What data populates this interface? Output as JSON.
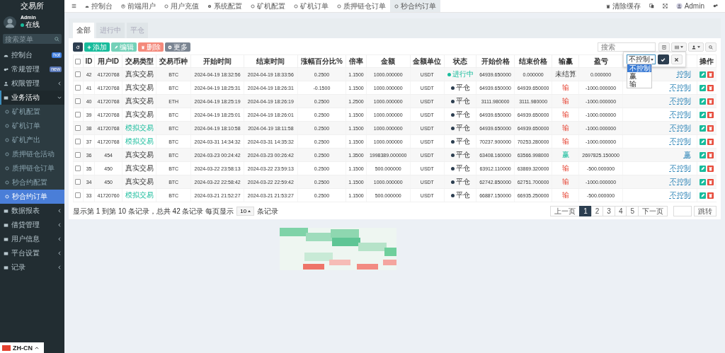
{
  "sidebar": {
    "title": "交易所",
    "user": {
      "name": "Admin",
      "status": "在线"
    },
    "search": {
      "placeholder": "搜索菜单"
    },
    "items": [
      {
        "label": "控制台",
        "badge": {
          "text": "hot",
          "color": "#3f7fe0"
        }
      },
      {
        "label": "常规管理",
        "badge": {
          "text": "new",
          "color": "#5a78b8"
        }
      },
      {
        "label": "权限管理",
        "expanded": false
      },
      {
        "label": "业务活动",
        "expanded": true,
        "children": [
          {
            "label": "矿机配置",
            "selected": false
          },
          {
            "label": "矿机订单",
            "selected": false
          },
          {
            "label": "矿机产出",
            "selected": false
          },
          {
            "label": "质押链仓活动",
            "selected": false
          },
          {
            "label": "质押链仓订单",
            "selected": false
          },
          {
            "label": "秒合约配置",
            "selected": false
          },
          {
            "label": "秒合约订单",
            "selected": true
          }
        ]
      },
      {
        "label": "数据报表",
        "expanded": false
      },
      {
        "label": "借贷管理",
        "expanded": false
      },
      {
        "label": "用户信息",
        "expanded": false
      },
      {
        "label": "平台设置",
        "expanded": false
      },
      {
        "label": "记录",
        "expanded": false
      }
    ],
    "language": "ZH-CN"
  },
  "top_nav": {
    "items": [
      {
        "label": "控制台",
        "selected": false
      },
      {
        "label": "前端用户",
        "selected": false
      },
      {
        "label": "用户充值",
        "selected": false
      },
      {
        "label": "系统配置",
        "selected": false
      },
      {
        "label": "矿机配置",
        "selected": false
      },
      {
        "label": "矿机订单",
        "selected": false
      },
      {
        "label": "质押链仓订单",
        "selected": false
      },
      {
        "label": "秒合约订单",
        "selected": true
      }
    ],
    "clear_cache": "清除缓存",
    "user": "Admin"
  },
  "tabs": [
    {
      "label": "全部",
      "selected": true
    },
    {
      "label": "进行中",
      "selected": false
    },
    {
      "label": "平仓",
      "selected": false
    }
  ],
  "toolbar": {
    "buttons": [
      {
        "kind": "refresh"
      },
      {
        "kind": "add",
        "label": "添加"
      },
      {
        "kind": "edit",
        "label": "编辑"
      },
      {
        "kind": "delete",
        "label": "删除"
      },
      {
        "kind": "more",
        "label": "更多"
      }
    ],
    "search": {
      "placeholder": "搜索"
    }
  },
  "table": {
    "select_all": {
      "checked": false
    },
    "columns": [
      "ID",
      "用户ID",
      "交易类型",
      "交易币种",
      "开始时间",
      "结束时间",
      "涨幅百分比%",
      "倍率",
      "金额",
      "金额单位",
      "状态",
      "开始价格",
      "结束价格",
      "输赢",
      "盈亏",
      "",
      "操作"
    ],
    "rows": [
      {
        "checked": false,
        "id": "42",
        "user_id": "41720768",
        "type": {
          "text": "真实交易",
          "kind": "real"
        },
        "coin": "BTC",
        "start": "2024-04-19 18:32:56",
        "end": "2024-04-19 18:33:56",
        "change": "0.2500",
        "rate": "1.1500",
        "amount": "1000.000000",
        "unit": "USDT",
        "status": {
          "text": "进行中",
          "kind": "open"
        },
        "open_price": "64939.650000",
        "close_price": "0.000000",
        "result": {
          "text": "未结算",
          "kind": "pending"
        },
        "profit": "0.000000",
        "control": "控制"
      },
      {
        "checked": false,
        "id": "41",
        "user_id": "41720768",
        "type": {
          "text": "真实交易",
          "kind": "real"
        },
        "coin": "BTC",
        "start": "2024-04-19 18:25:31",
        "end": "2024-04-19 18:26:31",
        "change": "-0.1500",
        "rate": "1.1500",
        "amount": "1000.000000",
        "unit": "USDT",
        "status": {
          "text": "平仓",
          "kind": "closed"
        },
        "open_price": "64939.650000",
        "close_price": "64939.650000",
        "result": {
          "text": "输",
          "kind": "lose"
        },
        "profit": "-1000.000000",
        "control": "不控制"
      },
      {
        "checked": false,
        "id": "40",
        "user_id": "41720768",
        "type": {
          "text": "真实交易",
          "kind": "real"
        },
        "coin": "ETH",
        "start": "2024-04-19 18:25:19",
        "end": "2024-04-19 18:26:19",
        "change": "0.2500",
        "rate": "1.2500",
        "amount": "1000.000000",
        "unit": "USDT",
        "status": {
          "text": "平仓",
          "kind": "closed"
        },
        "open_price": "3111.980000",
        "close_price": "3111.980000",
        "result": {
          "text": "输",
          "kind": "lose"
        },
        "profit": "-1000.000000",
        "control": "不控制"
      },
      {
        "checked": false,
        "id": "39",
        "user_id": "41720768",
        "type": {
          "text": "真实交易",
          "kind": "real"
        },
        "coin": "BTC",
        "start": "2024-04-19 18:25:01",
        "end": "2024-04-19 18:26:01",
        "change": "0.2500",
        "rate": "1.1500",
        "amount": "1000.000000",
        "unit": "USDT",
        "status": {
          "text": "平仓",
          "kind": "closed"
        },
        "open_price": "64939.650000",
        "close_price": "64939.650000",
        "result": {
          "text": "输",
          "kind": "lose"
        },
        "profit": "-1000.000000",
        "control": "不控制"
      },
      {
        "checked": false,
        "id": "38",
        "user_id": "41720768",
        "type": {
          "text": "模拟交易",
          "kind": "simulated"
        },
        "coin": "BTC",
        "start": "2024-04-19 18:10:58",
        "end": "2024-04-19 18:11:58",
        "change": "0.2500",
        "rate": "1.1500",
        "amount": "1000.000000",
        "unit": "USDT",
        "status": {
          "text": "平仓",
          "kind": "closed"
        },
        "open_price": "64939.650000",
        "close_price": "64939.650000",
        "result": {
          "text": "输",
          "kind": "lose"
        },
        "profit": "-1000.000000",
        "control": "不控制"
      },
      {
        "checked": false,
        "id": "37",
        "user_id": "41720768",
        "type": {
          "text": "模拟交易",
          "kind": "simulated"
        },
        "coin": "BTC",
        "start": "2024-03-31 14:34:32",
        "end": "2024-03-31 14:35:32",
        "change": "0.2500",
        "rate": "1.1500",
        "amount": "1000.000000",
        "unit": "USDT",
        "status": {
          "text": "平仓",
          "kind": "closed"
        },
        "open_price": "70237.900000",
        "close_price": "70253.280000",
        "result": {
          "text": "输",
          "kind": "lose"
        },
        "profit": "-1000.000000",
        "control": "不控制"
      },
      {
        "checked": false,
        "id": "36",
        "user_id": "454",
        "type": {
          "text": "真实交易",
          "kind": "real"
        },
        "coin": "BTC",
        "start": "2024-03-23 00:24:42",
        "end": "2024-03-23 00:26:42",
        "change": "0.2500",
        "rate": "1.3500",
        "amount": "1998389.000000",
        "unit": "USDT",
        "status": {
          "text": "平仓",
          "kind": "closed"
        },
        "open_price": "63408.160000",
        "close_price": "63566.998000",
        "result": {
          "text": "赢",
          "kind": "win"
        },
        "profit": "2697825.150000",
        "control": "赢"
      },
      {
        "checked": false,
        "id": "35",
        "user_id": "450",
        "type": {
          "text": "真实交易",
          "kind": "real"
        },
        "coin": "BTC",
        "start": "2024-03-22 23:58:13",
        "end": "2024-03-22 23:59:13",
        "change": "0.2500",
        "rate": "1.1500",
        "amount": "500.000000",
        "unit": "USDT",
        "status": {
          "text": "平仓",
          "kind": "closed"
        },
        "open_price": "63912.110000",
        "close_price": "63869.320000",
        "result": {
          "text": "输",
          "kind": "lose"
        },
        "profit": "-500.000000",
        "control": "不控制"
      },
      {
        "checked": false,
        "id": "34",
        "user_id": "450",
        "type": {
          "text": "真实交易",
          "kind": "real"
        },
        "coin": "BTC",
        "start": "2024-03-22 22:58:42",
        "end": "2024-03-22 22:59:42",
        "change": "0.2500",
        "rate": "1.1500",
        "amount": "1000.000000",
        "unit": "USDT",
        "status": {
          "text": "平仓",
          "kind": "closed"
        },
        "open_price": "62742.850000",
        "close_price": "62751.700000",
        "result": {
          "text": "输",
          "kind": "lose"
        },
        "profit": "-1000.000000",
        "control": "不控制"
      },
      {
        "checked": false,
        "id": "33",
        "user_id": "41720760",
        "type": {
          "text": "模拟交易",
          "kind": "simulated"
        },
        "coin": "BTC",
        "start": "2024-03-21 21:52:27",
        "end": "2024-03-21 21:53:27",
        "change": "0.2500",
        "rate": "1.1500",
        "amount": "500.000000",
        "unit": "USDT",
        "status": {
          "text": "平仓",
          "kind": "closed"
        },
        "open_price": "66887.150000",
        "close_price": "66935.250000",
        "result": {
          "text": "输",
          "kind": "lose"
        },
        "profit": "-500.000000",
        "control": "不控制"
      }
    ]
  },
  "popover": {
    "value": "不控制",
    "options": [
      {
        "label": "不控制",
        "selected": true
      },
      {
        "label": "赢",
        "selected": false
      },
      {
        "label": "输",
        "selected": false
      }
    ]
  },
  "pagination": {
    "summary": "显示第 1 到第 10 条记录，总共 42 条记录 每页显示",
    "page_size": "10",
    "suffix": "条记录",
    "prev": "上一页",
    "pages": [
      {
        "label": "1",
        "selected": true
      },
      {
        "label": "2",
        "selected": false
      },
      {
        "label": "3",
        "selected": false
      },
      {
        "label": "4",
        "selected": false
      },
      {
        "label": "5",
        "selected": false
      }
    ],
    "next": "下一页",
    "jump": "跳转"
  }
}
